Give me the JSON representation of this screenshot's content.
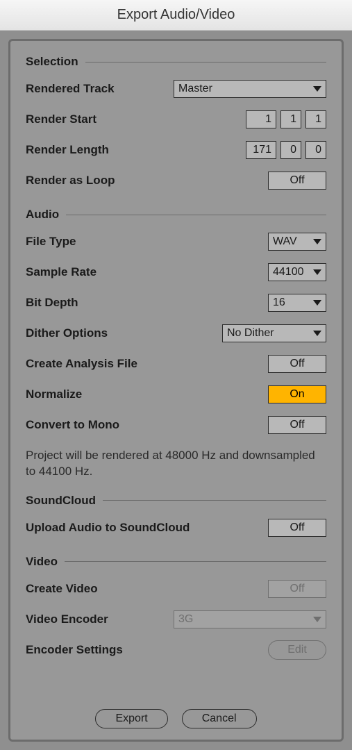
{
  "title": "Export Audio/Video",
  "sections": {
    "selection": {
      "header": "Selection",
      "rendered_track": {
        "label": "Rendered Track",
        "value": "Master"
      },
      "render_start": {
        "label": "Render Start",
        "bars": "1",
        "beats": "1",
        "sixteenths": "1"
      },
      "render_length": {
        "label": "Render Length",
        "bars": "171",
        "beats": "0",
        "sixteenths": "0"
      },
      "render_as_loop": {
        "label": "Render as Loop",
        "value": "Off"
      }
    },
    "audio": {
      "header": "Audio",
      "file_type": {
        "label": "File Type",
        "value": "WAV"
      },
      "sample_rate": {
        "label": "Sample Rate",
        "value": "44100"
      },
      "bit_depth": {
        "label": "Bit Depth",
        "value": "16"
      },
      "dither": {
        "label": "Dither Options",
        "value": "No Dither"
      },
      "analysis_file": {
        "label": "Create Analysis File",
        "value": "Off"
      },
      "normalize": {
        "label": "Normalize",
        "value": "On"
      },
      "mono": {
        "label": "Convert to Mono",
        "value": "Off"
      },
      "info": "Project will be rendered at 48000 Hz and downsampled to 44100 Hz."
    },
    "soundcloud": {
      "header": "SoundCloud",
      "upload": {
        "label": "Upload Audio to SoundCloud",
        "value": "Off"
      }
    },
    "video": {
      "header": "Video",
      "create": {
        "label": "Create Video",
        "value": "Off"
      },
      "encoder": {
        "label": "Video Encoder",
        "value": "3G"
      },
      "settings": {
        "label": "Encoder Settings",
        "button": "Edit"
      }
    }
  },
  "footer": {
    "export": "Export",
    "cancel": "Cancel"
  }
}
